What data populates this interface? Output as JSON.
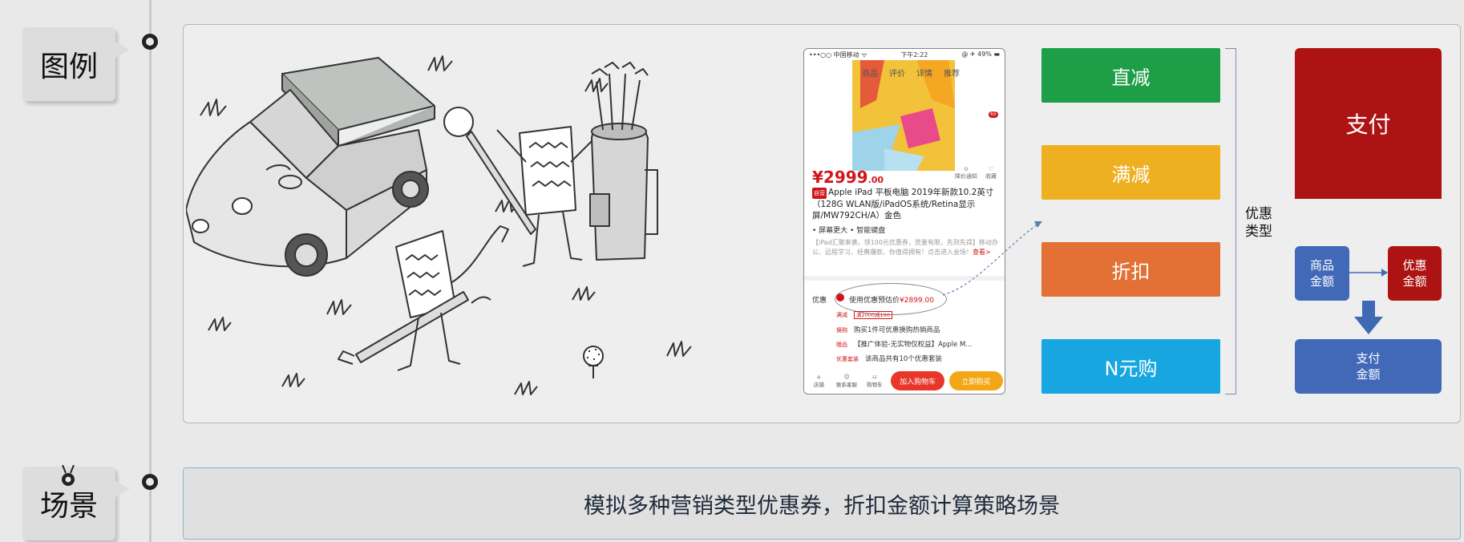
{
  "sections": {
    "legend_label": "图例",
    "scene_label": "场景"
  },
  "phone": {
    "carrier": "•••○○ 中国移动 ᯤ",
    "time": "下午2:22",
    "battery": "@ ✈ 49% ▬",
    "tabs": [
      "商品",
      "评价",
      "详情",
      "推荐"
    ],
    "price_main": "¥2999",
    "price_decimal": ".00",
    "icon_notify": "降价通知",
    "icon_fav": "收藏",
    "self_badge": "自营",
    "title": "Apple iPad 平板电脑 2019年新款10.2英寸（128G WLAN版/iPadOS系统/Retina显示屏/MW792CH/A）金色",
    "features": "• 屏幕更大  • 智能键盘",
    "desc_text": "【iPad汇聚来袭，领100元优惠券，货量有限，先到先得】移动办公、远程学习、经典爆款、你值得拥有！点击进入会场！",
    "desc_link": "查看>",
    "coupon_label": "优惠",
    "coupon_estimate": "使用优惠预估价",
    "coupon_estimate_price": "¥2899.00",
    "row1_tag": "满减",
    "row1_text": "满2000减100",
    "row2_tag": "换购",
    "row2_text": "购买1件可优惠换购热销商品",
    "row3_tag": "赠品",
    "row3_text": "【推广体验-无实物仅权益】Apple M...",
    "row4_tag": "优惠套装",
    "row4_text": "该商品共有10个优惠套装",
    "bottom_store": "店铺",
    "bottom_service": "联系客服",
    "bottom_cart": "购物车",
    "btn_cart": "加入购物车",
    "btn_buy": "立即购买",
    "mini_badge": "65"
  },
  "discount_types": {
    "label": "优惠\n类型",
    "items": [
      "直减",
      "满减",
      "折扣",
      "N元购"
    ]
  },
  "payment": {
    "pay": "支付",
    "goods_amount": "商品\n金额",
    "discount_amount": "优惠\n金额",
    "pay_amount": "支付\n金额"
  },
  "scene": {
    "text": "模拟多种营销类型优惠券，折扣金额计算策略场景"
  },
  "colors": {
    "direct": "#1d9e47",
    "full_reduction": "#eeb020",
    "discount": "#e37034",
    "n_yuan": "#17a6e0",
    "pay_red": "#ad1313",
    "amount_blue": "#4169b7"
  }
}
